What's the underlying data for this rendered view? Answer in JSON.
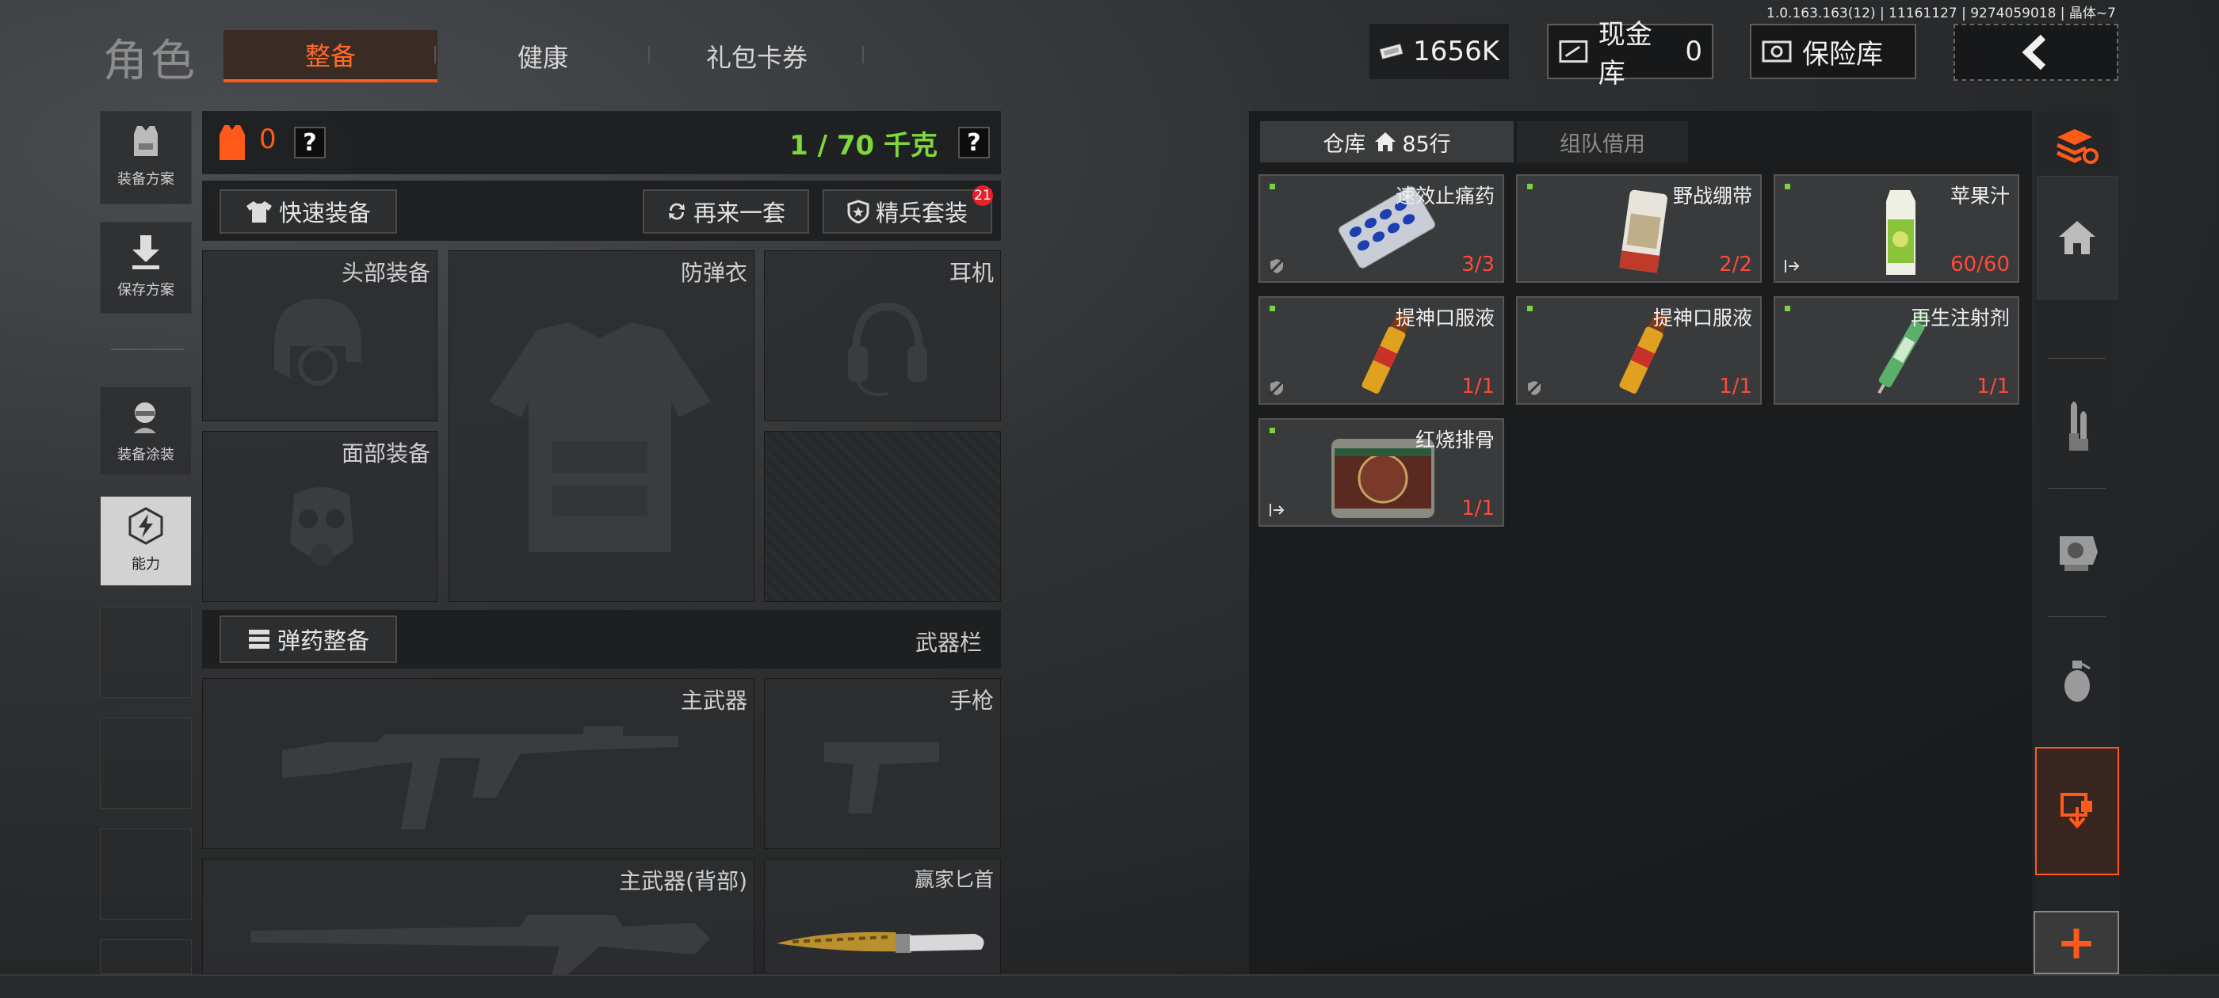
{
  "version_text": "1.0.163.163(12) | 11161127 | 9274059018 | 晶体~7",
  "header": {
    "title": "角色",
    "tabs": [
      {
        "label": "整备",
        "active": true
      },
      {
        "label": "健康",
        "active": false
      },
      {
        "label": "礼包卡券",
        "active": false
      }
    ],
    "money": "1656K",
    "cash_vault_label": "现金库",
    "cash_vault_value": "0",
    "safe_label": "保险库"
  },
  "left_menu": [
    {
      "label": "装备方案",
      "icon": "vest-icon"
    },
    {
      "label": "保存方案",
      "icon": "download-icon"
    },
    {
      "label": "装备涂装",
      "icon": "soldier-paint-icon"
    },
    {
      "label": "能力",
      "icon": "lightning-hex-icon",
      "active": true
    }
  ],
  "loadout": {
    "armor_value": "0",
    "weight": "1 / 70 千克",
    "help": "?",
    "quick_equip": "快速装备",
    "again": "再来一套",
    "elite_kit": "精兵套装",
    "elite_badge": "21",
    "slots": {
      "head": "头部装备",
      "armor": "防弹衣",
      "ear": "耳机",
      "face": "面部装备"
    },
    "ammo_equip": "弹药整备",
    "weapon_bar": "武器栏",
    "weapons": {
      "primary": "主武器",
      "pistol": "手枪",
      "primary_back": "主武器(背部)",
      "knife": "赢家匕首"
    }
  },
  "inventory": {
    "tab_warehouse": "仓库",
    "tab_rows": "85行",
    "tab_team": "组队借用",
    "items": [
      {
        "name": "速效止痛药",
        "qty": "3/3",
        "art": "pills"
      },
      {
        "name": "野战绷带",
        "qty": "2/2",
        "art": "bandage"
      },
      {
        "name": "苹果汁",
        "qty": "60/60",
        "art": "juice"
      },
      {
        "name": "提神口服液",
        "qty": "1/1",
        "art": "vial"
      },
      {
        "name": "提神口服液",
        "qty": "1/1",
        "art": "vial"
      },
      {
        "name": "再生注射剂",
        "qty": "1/1",
        "art": "syringe"
      },
      {
        "name": "红烧排骨",
        "qty": "1/1",
        "art": "can"
      }
    ]
  },
  "right_sidebar": {
    "icons": [
      "stack-refresh-icon",
      "home-icon",
      "ammo-icon",
      "scope-icon",
      "grenade-icon",
      "storage-download-icon"
    ],
    "add": "+"
  },
  "colors": {
    "accent": "#ff5a1a",
    "weight_green": "#7fd83a",
    "qty_red": "#ff4a3a"
  }
}
